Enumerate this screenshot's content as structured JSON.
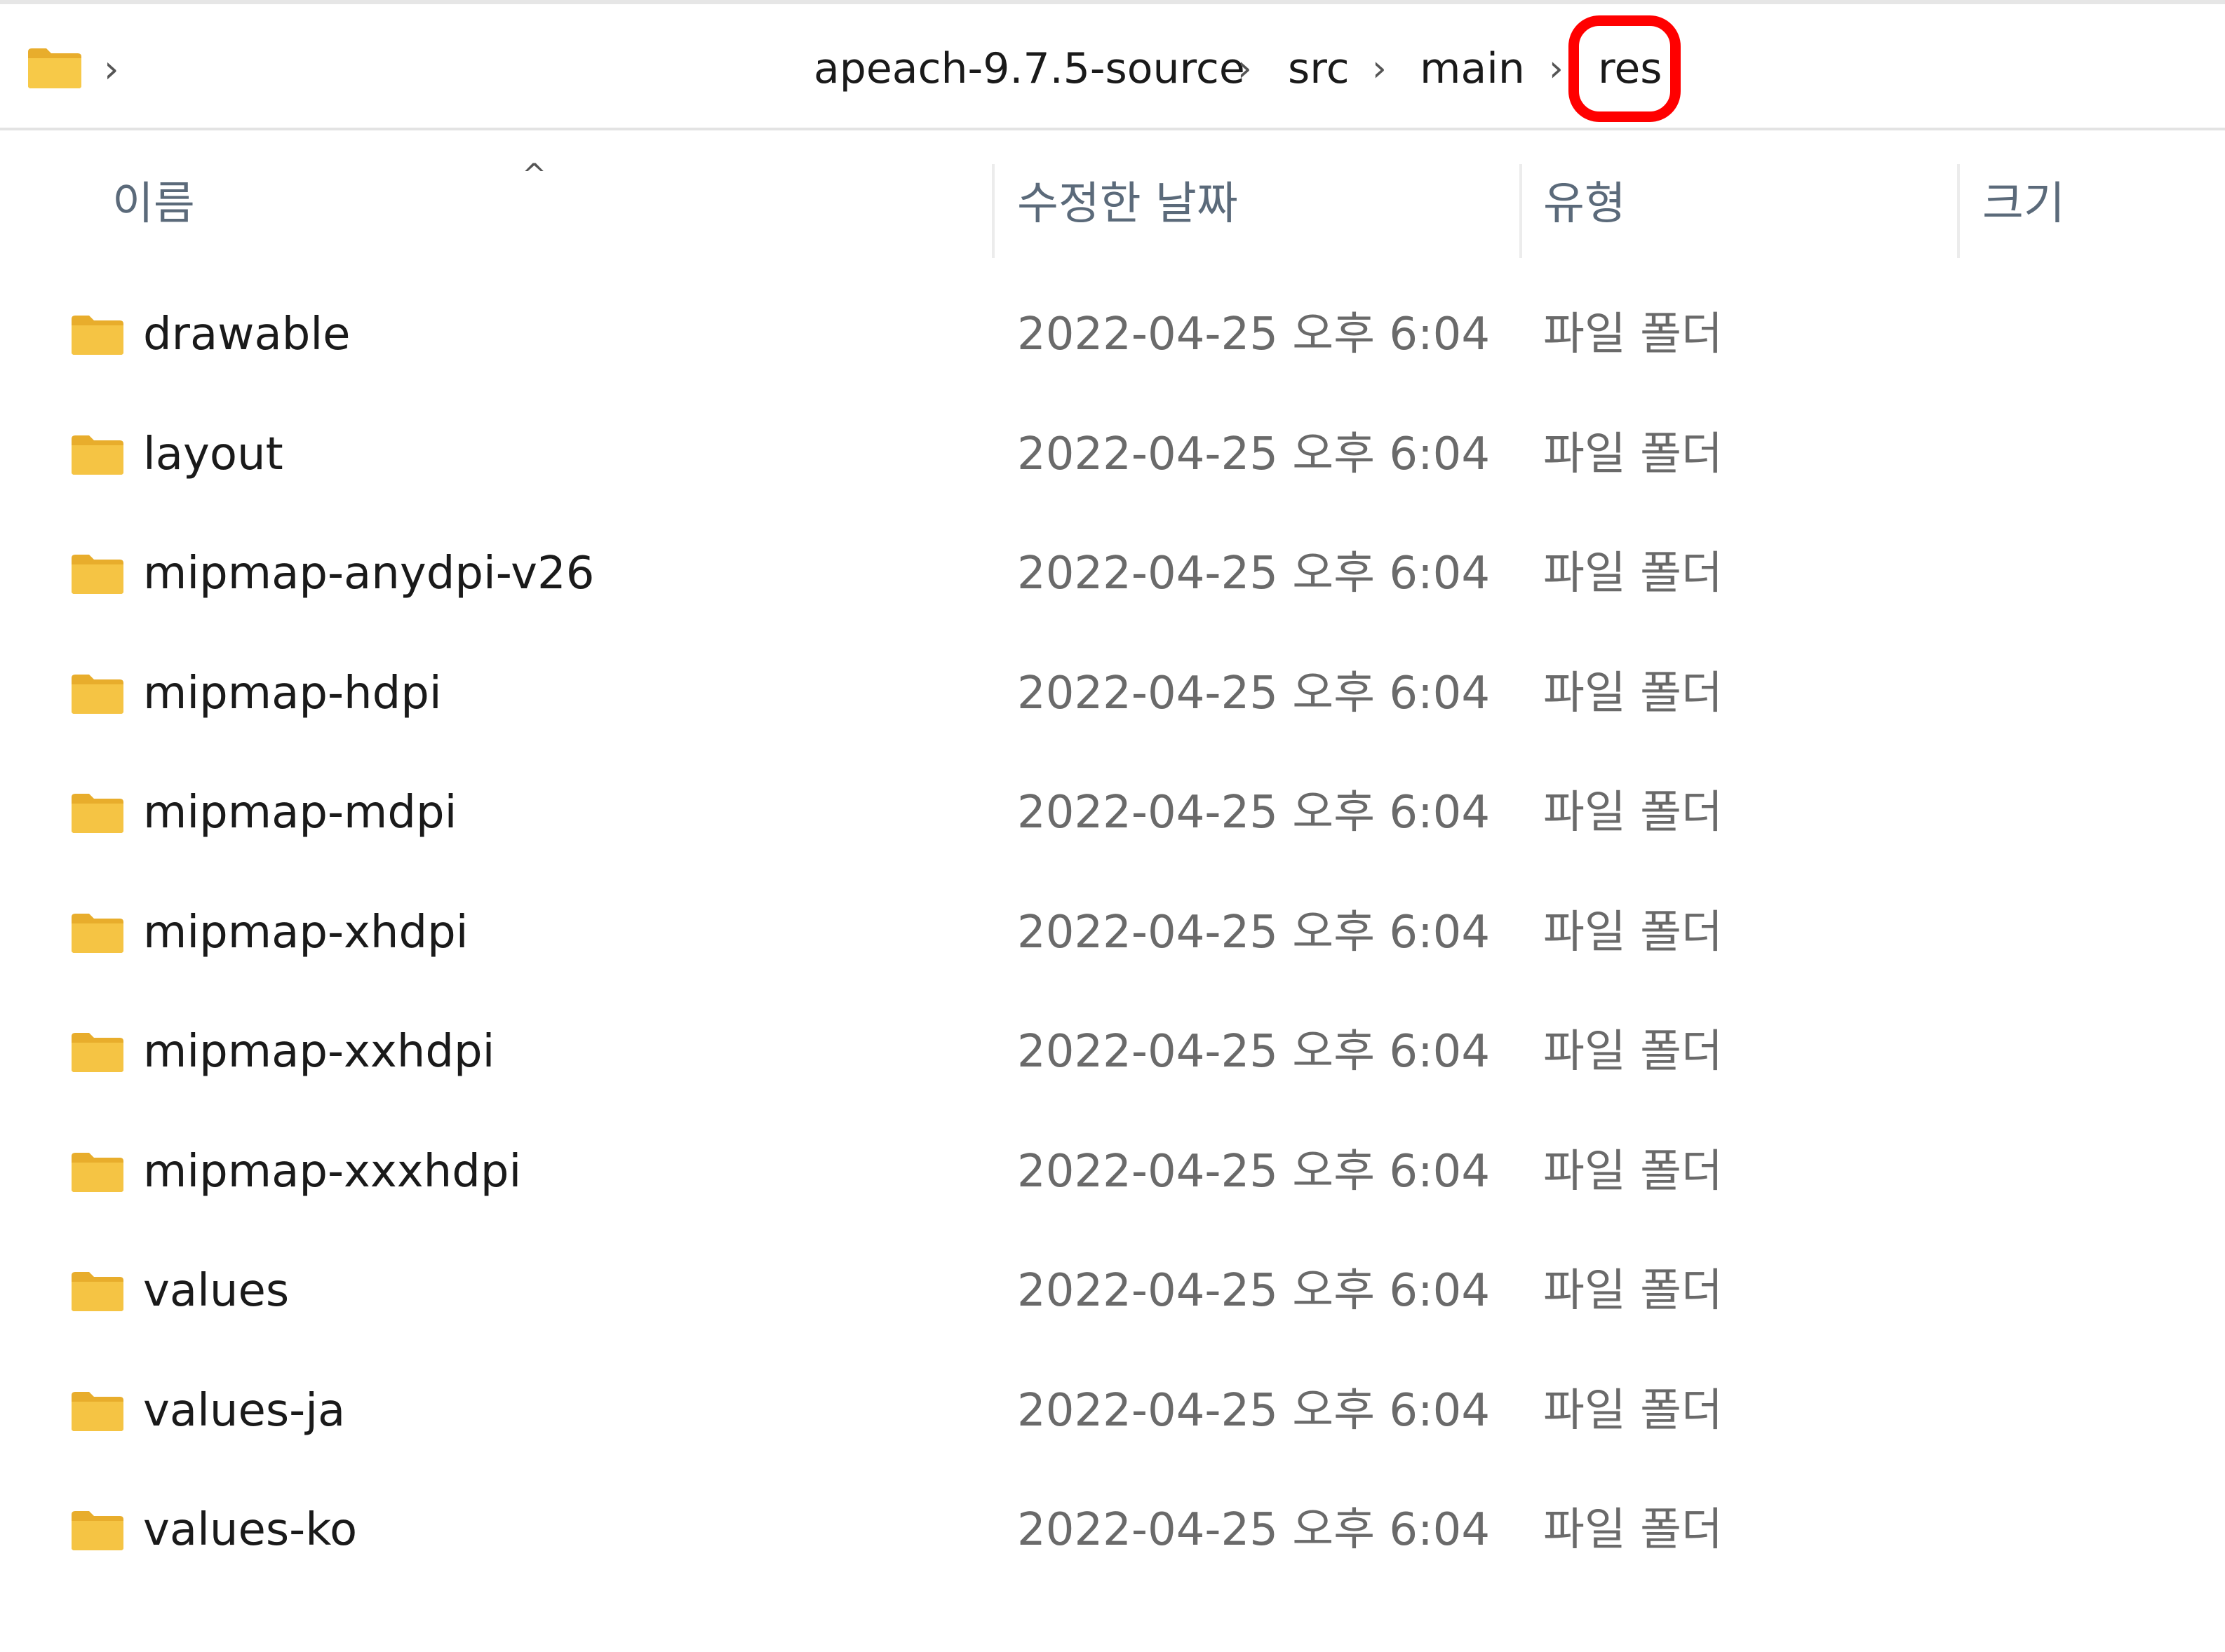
{
  "breadcrumb": {
    "chevron": "›",
    "items": [
      {
        "label": "apeach-9.7.5-source"
      },
      {
        "label": "src"
      },
      {
        "label": "main"
      },
      {
        "label": "res"
      }
    ],
    "highlighted_item": "res",
    "highlight_color": "#ff0000"
  },
  "columns": {
    "name": "이름",
    "modified": "수정한 날짜",
    "type": "유형",
    "size": "크기",
    "sort_caret": "^"
  },
  "folder_icon_color": "#f5c444",
  "rows": [
    {
      "name": "drawable",
      "modified": "2022-04-25 오후 6:04",
      "type": "파일 폴더",
      "size": ""
    },
    {
      "name": "layout",
      "modified": "2022-04-25 오후 6:04",
      "type": "파일 폴더",
      "size": ""
    },
    {
      "name": "mipmap-anydpi-v26",
      "modified": "2022-04-25 오후 6:04",
      "type": "파일 폴더",
      "size": ""
    },
    {
      "name": "mipmap-hdpi",
      "modified": "2022-04-25 오후 6:04",
      "type": "파일 폴더",
      "size": ""
    },
    {
      "name": "mipmap-mdpi",
      "modified": "2022-04-25 오후 6:04",
      "type": "파일 폴더",
      "size": ""
    },
    {
      "name": "mipmap-xhdpi",
      "modified": "2022-04-25 오후 6:04",
      "type": "파일 폴더",
      "size": ""
    },
    {
      "name": "mipmap-xxhdpi",
      "modified": "2022-04-25 오후 6:04",
      "type": "파일 폴더",
      "size": ""
    },
    {
      "name": "mipmap-xxxhdpi",
      "modified": "2022-04-25 오후 6:04",
      "type": "파일 폴더",
      "size": ""
    },
    {
      "name": "values",
      "modified": "2022-04-25 오후 6:04",
      "type": "파일 폴더",
      "size": ""
    },
    {
      "name": "values-ja",
      "modified": "2022-04-25 오후 6:04",
      "type": "파일 폴더",
      "size": ""
    },
    {
      "name": "values-ko",
      "modified": "2022-04-25 오후 6:04",
      "type": "파일 폴더",
      "size": ""
    }
  ]
}
